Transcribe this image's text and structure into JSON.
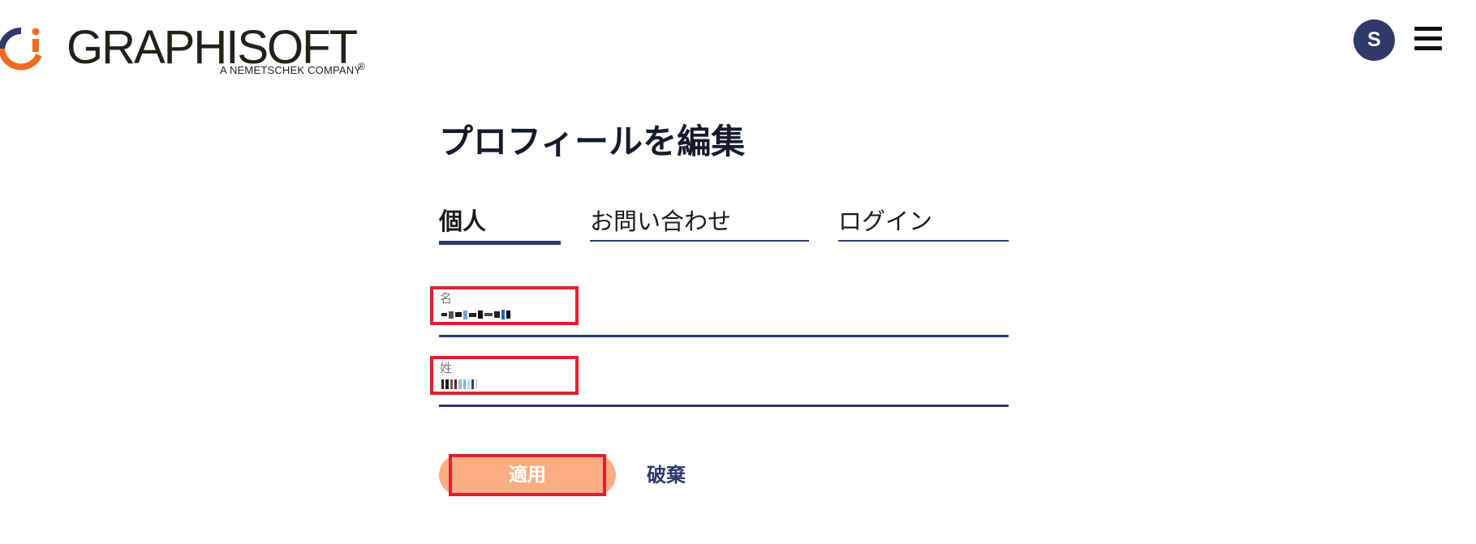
{
  "header": {
    "logo_text": "GRAPHISOFT",
    "logo_registered": "®",
    "logo_subtitle": "A NEMETSCHEK COMPANY",
    "avatar_initial": "S",
    "menu_icon": "hamburger-menu-icon",
    "logo_icon": "graphisoft-logo-mark-icon"
  },
  "page": {
    "title": "プロフィールを編集"
  },
  "tabs": [
    {
      "label": "個人",
      "active": true
    },
    {
      "label": "お問い合わせ",
      "active": false
    },
    {
      "label": "ログイン",
      "active": false
    }
  ],
  "form": {
    "first_name": {
      "label": "名"
    },
    "last_name": {
      "label": "姓"
    },
    "apply_label": "適用",
    "discard_label": "破棄"
  },
  "colors": {
    "accent": "#2f3a6a",
    "apply_button": "#f9ad83",
    "highlight_box": "#e0202a",
    "logo_orange": "#f26b21",
    "logo_navy": "#2f3a6a"
  }
}
